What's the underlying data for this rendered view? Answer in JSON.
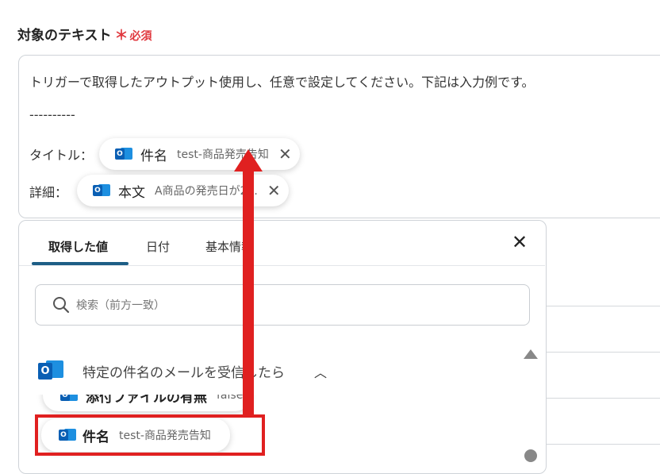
{
  "field": {
    "label": "対象のテキスト",
    "required_mark": "＊",
    "required_text": "必須"
  },
  "textarea": {
    "line1": "トリガーで取得したアウトプット使用し、任意で設定してください。下記は入力例です。",
    "line2": "----------",
    "title_label": "タイトル：",
    "detail_label": "詳細：",
    "chip_title": {
      "name": "件名",
      "value": "test-商品発売告知",
      "remove": "✕"
    },
    "chip_body": {
      "name": "本文",
      "value": "A商品の発売日が2...",
      "remove": "✕"
    }
  },
  "panel": {
    "tabs": [
      {
        "label": "取得した値"
      },
      {
        "label": "日付"
      },
      {
        "label": "基本情報"
      }
    ],
    "close": "✕",
    "search_placeholder": "検索（前方一致）",
    "group_title": "特定の件名のメールを受信したら",
    "group_chevron": "︿",
    "partial_item": {
      "name": "添付ファイルの有無",
      "value": "false"
    },
    "item": {
      "name": "件名",
      "value": "test-商品発売告知"
    }
  },
  "colors": {
    "required": "#e0383e",
    "tab_underline": "#1d5e86",
    "annotation_red": "#e02020",
    "outlook_blue": "#0a5fb4"
  },
  "icons": [
    "outlook-icon",
    "search-icon",
    "close-icon",
    "chevron-up-icon",
    "scroll-up-icon",
    "scroll-down-icon"
  ]
}
